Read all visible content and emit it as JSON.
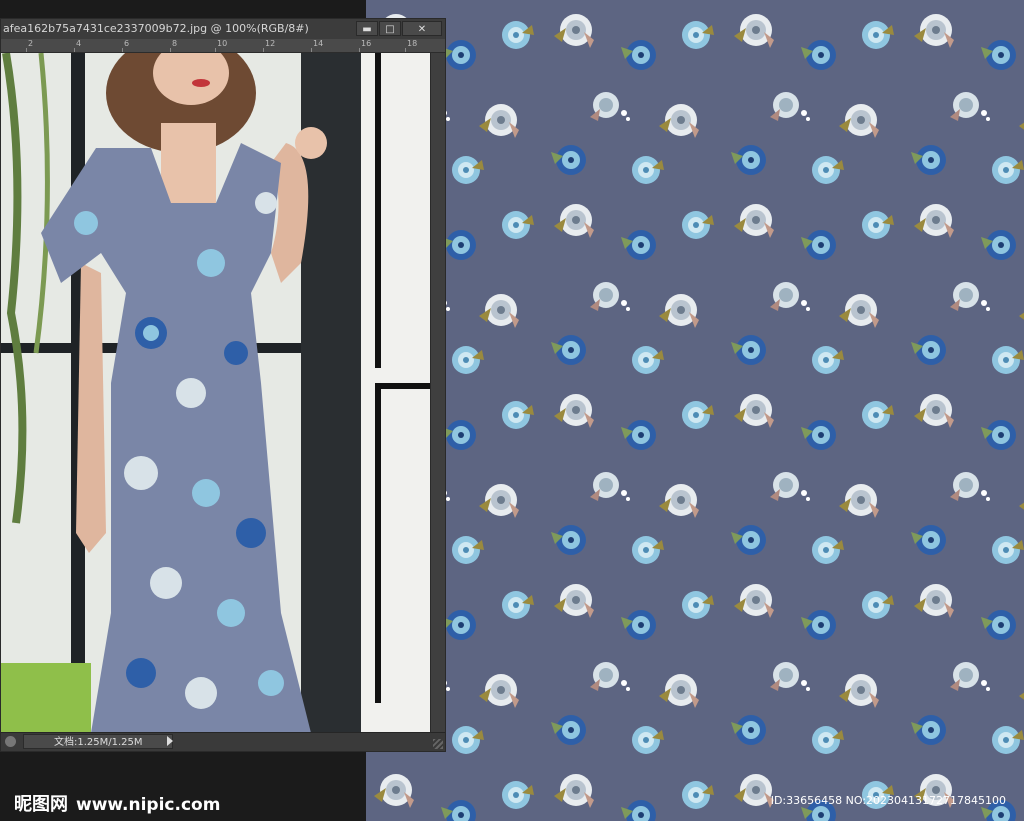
{
  "window": {
    "title": "afea162b75a7431ce2337009b72.jpg @ 100%(RGB/8#)",
    "controls": {
      "minimize": "▬",
      "maximize": "□",
      "close": "✕"
    }
  },
  "ruler": {
    "labels": [
      "2",
      "4",
      "6",
      "8",
      "10",
      "12",
      "14",
      "16",
      "18"
    ]
  },
  "statusbar": {
    "doc_info": "文档:1.25M/1.25M"
  },
  "watermark": {
    "brand": "昵图网",
    "url": "www.nipic.com"
  },
  "image_id": "ID:33656458 NO:20230413172717845100",
  "colors": {
    "pattern_bg": "#5d6582",
    "dress": "#7a86a7",
    "flower_blue": "#2e5fa8",
    "flower_light": "#8fc6e0",
    "flower_white": "#e8ecef",
    "leaf_olive": "#9a8a3e"
  }
}
